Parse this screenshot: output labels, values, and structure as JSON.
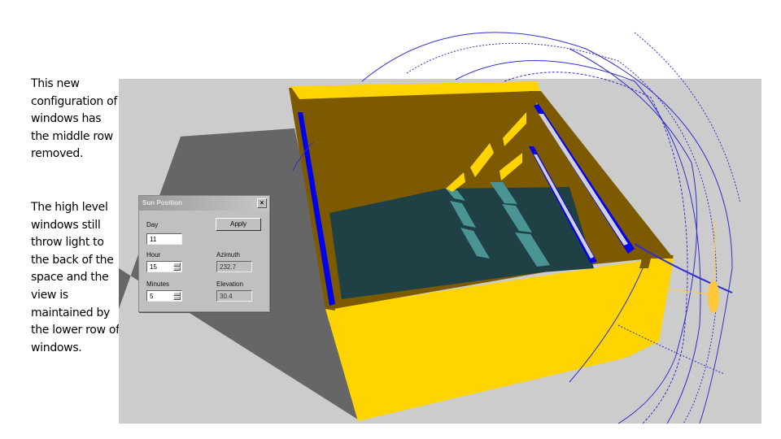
{
  "captions": {
    "first": "This new configuration of windows has the middle row removed.",
    "second": "The high level windows still throw light to the back of the space and the view is maintained by the lower row of windows."
  },
  "scene": {
    "description": "3D sun-path model of a room with high-level clerestory windows",
    "colors": {
      "background": "#cccccc",
      "shadow": "#666666",
      "wall_outer": "#ffd400",
      "wall_inner": "#7d5a00",
      "floor": "#1f4044",
      "sun_patch": "#4a9493",
      "window_frame": "#0000ee",
      "window_glass": "#cfcfe0",
      "sunpath_lines": "#3030cc",
      "sun": "#ffc83a"
    }
  },
  "dialog": {
    "title": "Sun Position",
    "close_label": "×",
    "apply_label": "Apply",
    "day_label": "Day",
    "day_value": "11",
    "hour_label": "Hour",
    "hour_value": "15",
    "minutes_label": "Minutes",
    "minutes_value": "5",
    "azimuth_label": "Azimuth",
    "azimuth_value": "232.7",
    "elevation_label": "Elevation",
    "elevation_value": "30.4"
  }
}
